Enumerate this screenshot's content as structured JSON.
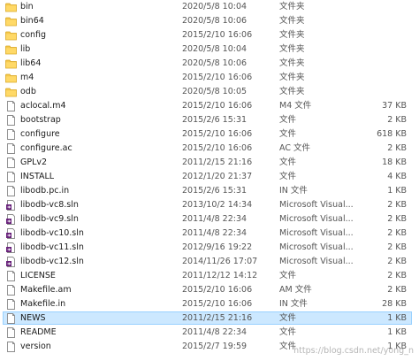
{
  "files": [
    {
      "name": "bin",
      "modified": "2020/5/8 10:04",
      "type": "文件夹",
      "size": "",
      "icon": "folder-icon"
    },
    {
      "name": "bin64",
      "modified": "2020/5/8 10:06",
      "type": "文件夹",
      "size": "",
      "icon": "folder-icon"
    },
    {
      "name": "config",
      "modified": "2015/2/10 16:06",
      "type": "文件夹",
      "size": "",
      "icon": "folder-icon"
    },
    {
      "name": "lib",
      "modified": "2020/5/8 10:04",
      "type": "文件夹",
      "size": "",
      "icon": "folder-icon"
    },
    {
      "name": "lib64",
      "modified": "2020/5/8 10:06",
      "type": "文件夹",
      "size": "",
      "icon": "folder-icon"
    },
    {
      "name": "m4",
      "modified": "2015/2/10 16:06",
      "type": "文件夹",
      "size": "",
      "icon": "folder-icon"
    },
    {
      "name": "odb",
      "modified": "2020/5/8 10:05",
      "type": "文件夹",
      "size": "",
      "icon": "folder-icon"
    },
    {
      "name": "aclocal.m4",
      "modified": "2015/2/10 16:06",
      "type": "M4 文件",
      "size": "37 KB",
      "icon": "file-icon"
    },
    {
      "name": "bootstrap",
      "modified": "2015/2/6 15:31",
      "type": "文件",
      "size": "2 KB",
      "icon": "file-icon"
    },
    {
      "name": "configure",
      "modified": "2015/2/10 16:06",
      "type": "文件",
      "size": "618 KB",
      "icon": "file-icon"
    },
    {
      "name": "configure.ac",
      "modified": "2015/2/10 16:06",
      "type": "AC 文件",
      "size": "2 KB",
      "icon": "file-icon"
    },
    {
      "name": "GPLv2",
      "modified": "2011/2/15 21:16",
      "type": "文件",
      "size": "18 KB",
      "icon": "file-icon"
    },
    {
      "name": "INSTALL",
      "modified": "2012/1/20 21:37",
      "type": "文件",
      "size": "4 KB",
      "icon": "file-icon"
    },
    {
      "name": "libodb.pc.in",
      "modified": "2015/2/6 15:31",
      "type": "IN 文件",
      "size": "1 KB",
      "icon": "file-icon"
    },
    {
      "name": "libodb-vc8.sln",
      "modified": "2013/10/2 14:34",
      "type": "Microsoft Visual...",
      "size": "2 KB",
      "icon": "vs-solution-icon"
    },
    {
      "name": "libodb-vc9.sln",
      "modified": "2011/4/8 22:34",
      "type": "Microsoft Visual...",
      "size": "2 KB",
      "icon": "vs-solution-icon"
    },
    {
      "name": "libodb-vc10.sln",
      "modified": "2011/4/8 22:34",
      "type": "Microsoft Visual...",
      "size": "2 KB",
      "icon": "vs-solution-icon"
    },
    {
      "name": "libodb-vc11.sln",
      "modified": "2012/9/16 19:22",
      "type": "Microsoft Visual...",
      "size": "2 KB",
      "icon": "vs-solution-icon"
    },
    {
      "name": "libodb-vc12.sln",
      "modified": "2014/11/26 17:07",
      "type": "Microsoft Visual...",
      "size": "2 KB",
      "icon": "vs-solution-icon"
    },
    {
      "name": "LICENSE",
      "modified": "2011/12/12 14:12",
      "type": "文件",
      "size": "2 KB",
      "icon": "file-icon"
    },
    {
      "name": "Makefile.am",
      "modified": "2015/2/10 16:06",
      "type": "AM 文件",
      "size": "2 KB",
      "icon": "file-icon"
    },
    {
      "name": "Makefile.in",
      "modified": "2015/2/10 16:06",
      "type": "IN 文件",
      "size": "28 KB",
      "icon": "file-icon"
    },
    {
      "name": "NEWS",
      "modified": "2011/2/15 21:16",
      "type": "文件",
      "size": "1 KB",
      "icon": "file-icon",
      "selected": true
    },
    {
      "name": "README",
      "modified": "2011/4/8 22:34",
      "type": "文件",
      "size": "1 KB",
      "icon": "file-icon"
    },
    {
      "name": "version",
      "modified": "2015/2/7 19:59",
      "type": "文件",
      "size": "1 KB",
      "icon": "file-icon"
    }
  ],
  "watermark": "https://blog.csdn.net/yong_n"
}
